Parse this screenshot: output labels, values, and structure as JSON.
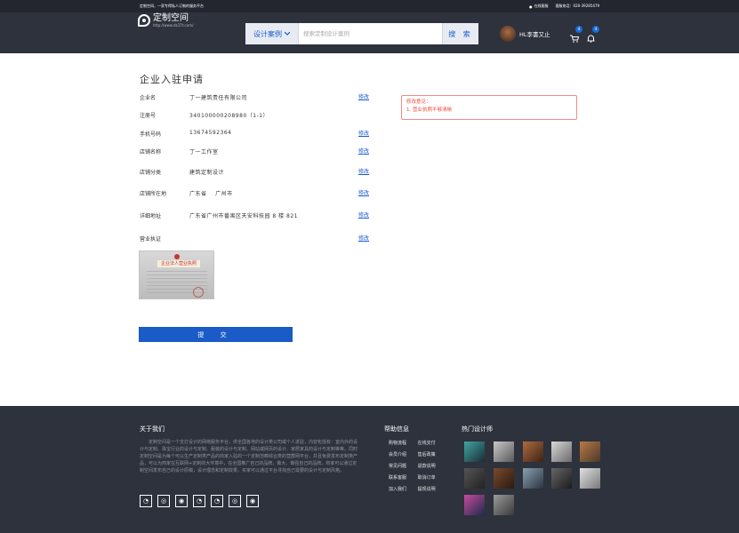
{
  "topbar": {
    "slogan": "定制空间，一家专得私人订制的服务平台",
    "store_label": "在线客服",
    "phone_label": "客服电话：020-39285479"
  },
  "header": {
    "logo_title": "定制空间",
    "logo_url": "http://www.dz37t.com/",
    "search_category": "设计案例",
    "search_placeholder": "搜索定制设计案例",
    "search_button": "搜 索",
    "user_name": "HL李書又止",
    "cart_count": "4",
    "bell_count": "4"
  },
  "form": {
    "title": "企业入驻申请",
    "edit_label": "修改",
    "fields": [
      {
        "label": "企业名",
        "value": "丁一建筑责任有限公司",
        "editable": true
      },
      {
        "label": "注册号",
        "value": "340100000208980（1-1）",
        "editable": false
      },
      {
        "label": "手机号码",
        "value": "13674592364",
        "editable": true
      },
      {
        "label": "店铺名称",
        "value": "丁一工作室",
        "editable": true
      },
      {
        "label": "店铺分类",
        "value": "建筑定制设计",
        "editable": true
      },
      {
        "label": "店铺所在地",
        "value": "广东省    广州市",
        "editable": true
      },
      {
        "label": "详细地址",
        "value": "广东省广州市番禺区天安科技园 8 楼 821",
        "editable": true
      },
      {
        "label": "营业执证",
        "value": "",
        "editable": true
      }
    ],
    "license_image_text": "企业法人营业执照",
    "submit_label": "提 交"
  },
  "notice": {
    "title": "修改意见：",
    "item": "1. 营业执照不够清晰"
  },
  "footer": {
    "about_title": "关于我们",
    "about_text": "定制空间是一个支打设计的网络服务平台，供全国各地的设计类公司或个人进驻，内容包括有：室内外的设计与定制、珠宝行业的设计与定制、服装的设计与定制、网站或网页的设计、家居家具的设计与定制等等。同时定制空间是为每个可以生产定制类产品的商家入驻的一个定制范畴综合类的营群网平台，并且免费发布定制类产品，可以为商家在互联网+定制的大环境中，在全国推广自己的品牌，做大、做强自己的品牌。商家可以通过定制空间发布自己的设计原稿，设计理念和定制效果，买家可以通过平台寻找自己需要的设计与定制风格。",
    "social_icons": [
      "qq-icon",
      "wechat-icon",
      "weibo-icon",
      "qq-icon",
      "qq-icon",
      "wechat-icon",
      "weibo-icon"
    ],
    "help_title": "帮助信息",
    "help_col1": [
      "购物流程",
      "会员介绍",
      "常见问题",
      "联系客服",
      "加入我们"
    ],
    "help_col2": [
      "在线支付",
      "售后政策",
      "退款说明",
      "取消订单",
      "提现说明"
    ],
    "designers_title": "热门设计师"
  }
}
